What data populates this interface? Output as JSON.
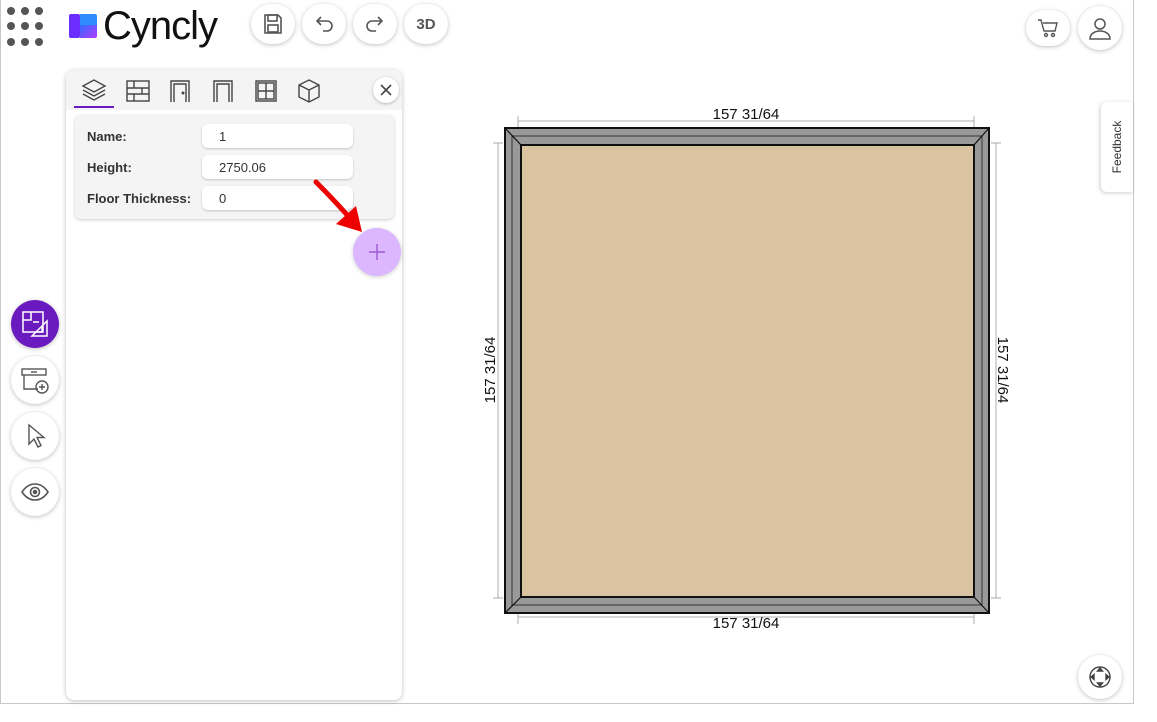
{
  "header": {
    "brand": "Cyncly",
    "buttons": {
      "save": "save-icon",
      "undo": "undo-icon",
      "redo": "redo-icon",
      "view3d": "3D"
    },
    "right": {
      "cart": "cart-icon",
      "user": "user-icon"
    }
  },
  "left_tools": [
    "floor-plan-icon",
    "add-cabinet-icon",
    "cursor-icon",
    "eye-icon"
  ],
  "panel": {
    "tabs": [
      "layers-icon",
      "wall-icon",
      "door-icon",
      "opening-icon",
      "window-icon",
      "cube-icon"
    ],
    "active_tab": 0,
    "properties": {
      "name_label": "Name:",
      "name_value": "1",
      "height_label": "Height:",
      "height_value": "2750.06",
      "floor_label": "Floor Thickness:",
      "floor_value": "0"
    },
    "add_button": "plus-icon"
  },
  "canvas": {
    "dim_top": "157 31/64",
    "dim_bottom": "157 31/64",
    "dim_left": "157 31/64",
    "dim_right": "157 31/64",
    "floor_color": "#d9c3a0",
    "wall_color": "#999999"
  },
  "feedback_label": "Feedback",
  "colors": {
    "accent": "#6a1bc0",
    "accent_light": "#dcb6ff",
    "annotation_arrow": "#ee0000"
  }
}
